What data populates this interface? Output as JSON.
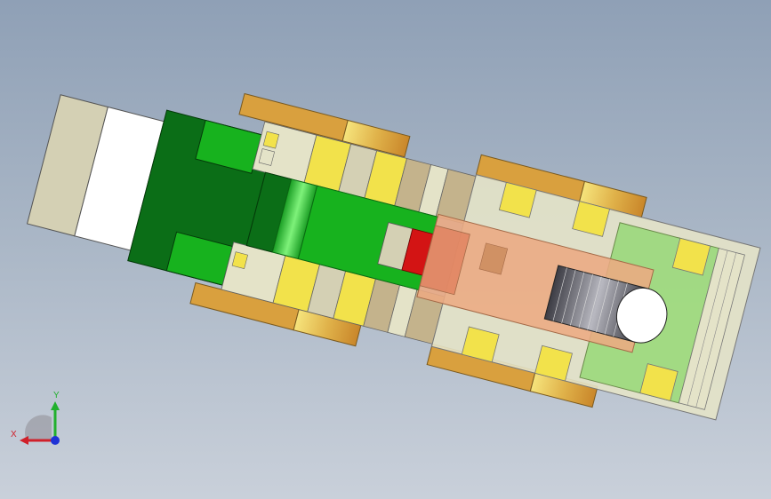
{
  "viewport": {
    "background_top": "#8fa0b6",
    "background_bottom": "#c9d0da"
  },
  "triad": {
    "x_label": "X",
    "y_label": "Y",
    "x_color": "#d0202a",
    "y_color": "#21b02d",
    "z_color": "#1f33d6"
  },
  "model": {
    "colors": {
      "dark_green": "#0b6e17",
      "green": "#17b21e",
      "light_green": "#97d877",
      "gold": "#d9a03e",
      "yellow": "#f2e24b",
      "cream": "#e4e3c8",
      "beige": "#d4d0b4",
      "tan": "#c4b38c",
      "salmon": "#ecaa82",
      "red": "#d31414",
      "grey_cyl": "#6a6a70",
      "white": "#ffffff"
    }
  }
}
